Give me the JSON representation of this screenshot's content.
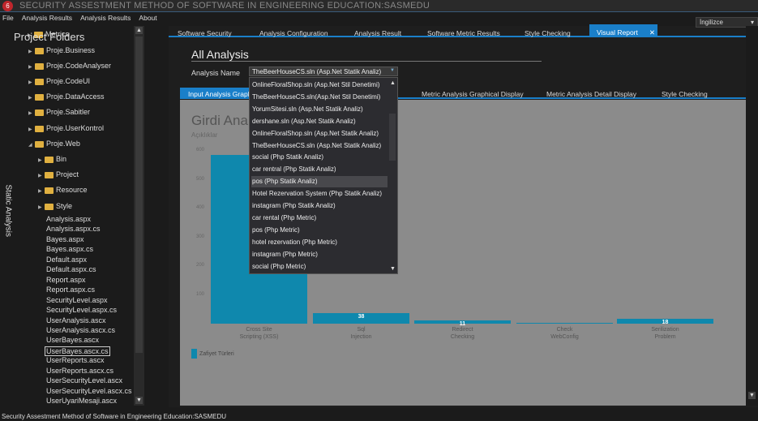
{
  "window": {
    "title": "SECURITY ASSESTMENT METHOD OF SOFTWARE IN ENGINEERING EDUCATION:SASMEDU",
    "icon": "app-logo"
  },
  "menu": [
    "File",
    "Analysis Results",
    "Analysis Results",
    "About"
  ],
  "left": {
    "header": "Project Folders",
    "side_label": "Static Analysis",
    "folders": [
      "Metrics",
      "Proje.Business",
      "Proje.CodeAnalyser",
      "Proje.CodeUI",
      "Proje.DataAccess",
      "Proje.Sabitler",
      "Proje.UserKontrol",
      "Proje.Web"
    ],
    "subfolders": [
      "Bin",
      "Project",
      "Resource",
      "Style"
    ],
    "files": [
      "Analysis.aspx",
      "Analysis.aspx.cs",
      "Bayes.aspx",
      "Bayes.aspx.cs",
      "Default.aspx",
      "Default.aspx.cs",
      "Report.aspx",
      "Report.aspx.cs",
      "SecurityLevel.aspx",
      "SecurityLevel.aspx.cs",
      "UserAnalysis.ascx",
      "UserAnalysis.ascx.cs",
      "UserBayes.ascx",
      "UserBayes.ascx.cs",
      "UserReports.ascx",
      "UserReports.ascx.cs",
      "UserSecurityLevel.ascx",
      "UserSecurityLevel.ascx.cs",
      "UserUyariMesaji.ascx"
    ],
    "selected_file": "UserBayes.ascx.cs"
  },
  "language": "İngilizce",
  "tabs": [
    "Software Security",
    "Analysis Configuration",
    "Analysis Result",
    "Software Metric Results",
    "Style Checking",
    "Visual Report"
  ],
  "active_tab": "Visual Report",
  "close_glyph": "✕",
  "section_title": "All Analysis",
  "analysis_name_label": "Analysis Name",
  "combo_value": "TheBeerHouseCS.sln (Asp.Net Statik Analiz)",
  "dropdown_options": [
    "OnlineFloralShop.sln (Asp.Net Stil Denetimi)",
    "TheBeerHouseCS.sln(Asp.Net Stil Denetimi)",
    "YorumSitesi.sln  (Asp.Net Statik Analiz)",
    "dershane.sln  (Asp.Net Statik Analiz)",
    "OnlineFloralShop.sln  (Asp.Net Statik Analiz)",
    "TheBeerHouseCS.sln (Asp.Net Statik Analiz)",
    "social (Php Statik Analiz)",
    "car rentral (Php Statik Analiz)",
    "pos (Php Statik Analiz)",
    "Hotel Rezervation System (Php Statik Analiz)",
    "instagram (Php Statik Analiz)",
    "car rental (Php Metric)",
    "pos (Php Metric)",
    "hotel rezervation (Php Metric)",
    "instagram (Php Metric)",
    "social (Php Metric)"
  ],
  "dropdown_highlighted": "pos (Php Statik Analiz)",
  "subtabs": [
    "Input Analysis Graphical Display",
    "Metric Analysis Graphical Display",
    "Metric Analysis Detail Display",
    "Style Checking"
  ],
  "chart_data": {
    "type": "bar",
    "title": "Girdi Analizi",
    "ylabel": "Açıklıklar",
    "categories": [
      "Cross Site Scripting (XSS)",
      "Sql Injection",
      "Redirect Checking",
      "Check WebConfig",
      "Serilization Problem"
    ],
    "category_lines": [
      [
        "Cross Site",
        "Scripting (XSS)"
      ],
      [
        "Sql",
        "Injection"
      ],
      [
        "Redirect",
        "Checking"
      ],
      [
        "Check",
        "WebConfig"
      ],
      [
        "Serilization",
        "Problem"
      ]
    ],
    "values": [
      585,
      38,
      11,
      2,
      18
    ],
    "data_labels": [
      "",
      "38",
      "11",
      "",
      "18"
    ],
    "yticks": [
      100,
      200,
      300,
      400,
      500,
      600
    ],
    "ylim": [
      0,
      600
    ],
    "legend": "Zafiyet Türleri",
    "color": "#0f88ad"
  },
  "status": "Security Assestment Method of Software in Engineering Education:SASMEDU"
}
